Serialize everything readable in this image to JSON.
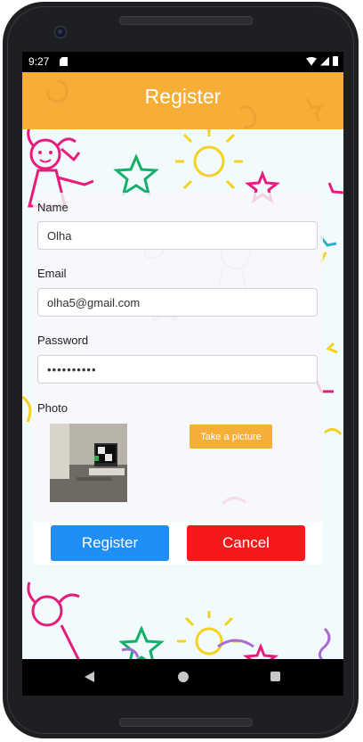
{
  "status_bar": {
    "time": "9:27",
    "icons": [
      "sd-card-icon",
      "wifi-icon",
      "signal-icon",
      "battery-icon"
    ]
  },
  "app_bar": {
    "title": "Register",
    "color": "#f6ae36"
  },
  "form": {
    "name": {
      "label": "Name",
      "value": "Olha"
    },
    "email": {
      "label": "Email",
      "value": "olha5@gmail.com"
    },
    "password": {
      "label": "Password",
      "value": "••••••••••"
    },
    "photo": {
      "label": "Photo",
      "take_picture_label": "Take a picture"
    }
  },
  "actions": {
    "register_label": "Register",
    "register_color": "#1f8ef6",
    "cancel_label": "Cancel",
    "cancel_color": "#f5191a"
  },
  "nav_bar": {
    "icons": [
      "back-icon",
      "home-icon",
      "recents-icon"
    ]
  }
}
